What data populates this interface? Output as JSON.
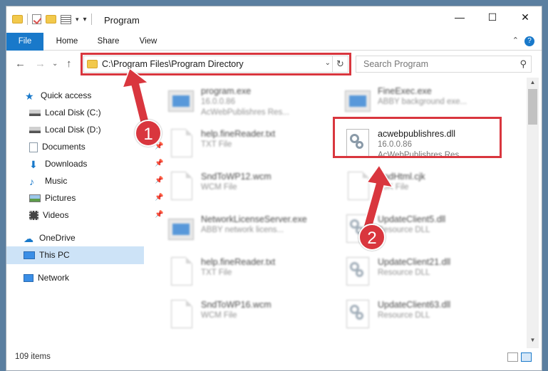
{
  "window": {
    "title": "Program",
    "controls": {
      "minimize": "—",
      "maximize": "☐",
      "close": "✕"
    }
  },
  "ribbon": {
    "tabs": [
      {
        "label": "File",
        "active": true
      },
      {
        "label": "Home"
      },
      {
        "label": "Share"
      },
      {
        "label": "View"
      }
    ],
    "help": "?",
    "collapse": "⌃"
  },
  "address": {
    "path": "C:\\Program Files\\Program Directory",
    "dropdown": "⌄",
    "refresh": "↻"
  },
  "search": {
    "placeholder": "Search Program",
    "icon": "search-icon"
  },
  "nav_buttons": {
    "back": "←",
    "forward": "→",
    "recent": "⌄",
    "up": "↑"
  },
  "sidebar": {
    "items": [
      {
        "label": "Quick access",
        "icon": "star-icon",
        "pinned": false
      },
      {
        "label": "Local Disk (C:)",
        "icon": "drive-icon",
        "pinned": true
      },
      {
        "label": "Local Disk (D:)",
        "icon": "drive-icon",
        "pinned": true
      },
      {
        "label": "Documents",
        "icon": "documents-icon",
        "pinned": true
      },
      {
        "label": "Downloads",
        "icon": "download-icon",
        "pinned": true
      },
      {
        "label": "Music",
        "icon": "music-icon",
        "pinned": true
      },
      {
        "label": "Pictures",
        "icon": "pictures-icon",
        "pinned": true
      },
      {
        "label": "Videos",
        "icon": "videos-icon",
        "pinned": true
      },
      {
        "label": "OneDrive",
        "icon": "cloud-icon",
        "pinned": false
      },
      {
        "label": "This PC",
        "icon": "computer-icon",
        "pinned": false,
        "selected": true
      },
      {
        "label": "Network",
        "icon": "network-icon",
        "pinned": false
      }
    ]
  },
  "files": [
    {
      "name": "program.exe",
      "line2": "16.0.0.86",
      "line3": "AcWebPublishres Res...",
      "icon": "exe-icon"
    },
    {
      "name": "FineExec.exe",
      "line2": "ABBY background exe...",
      "line3": "",
      "icon": "exe-icon"
    },
    {
      "name": "help.fineReader.txt",
      "line2": "TXT File",
      "line3": "",
      "icon": "document-icon"
    },
    {
      "name": "acwebpublishres.dll",
      "line2": "16.0.0.86",
      "line3": "AcWebPublishres Res...",
      "icon": "dll-gear-icon",
      "highlighted": true
    },
    {
      "name": "SndToWP12.wcm",
      "line2": "WCM File",
      "line3": "",
      "icon": "document-icon"
    },
    {
      "name": "SndHtml.cjk",
      "line2": "CJK File",
      "line3": "",
      "icon": "document-icon"
    },
    {
      "name": "NetworkLicenseServer.exe",
      "line2": "ABBY network licens...",
      "line3": "",
      "icon": "exe-icon"
    },
    {
      "name": "UpdateClient5.dll",
      "line2": "Resource DLL",
      "line3": "",
      "icon": "dll-gear-icon"
    },
    {
      "name": "help.fineReader.txt",
      "line2": "TXT File",
      "line3": "",
      "icon": "document-icon"
    },
    {
      "name": "UpdateClient21.dll",
      "line2": "Resource DLL",
      "line3": "",
      "icon": "dll-gear-icon"
    },
    {
      "name": "SndToWP16.wcm",
      "line2": "WCM File",
      "line3": "",
      "icon": "document-icon"
    },
    {
      "name": "UpdateClient63.dll",
      "line2": "Resource DLL",
      "line3": "",
      "icon": "dll-gear-icon"
    }
  ],
  "status": {
    "count": "109 items"
  },
  "annotations": {
    "step1": "1",
    "step2": "2",
    "color": "#d9363e"
  }
}
